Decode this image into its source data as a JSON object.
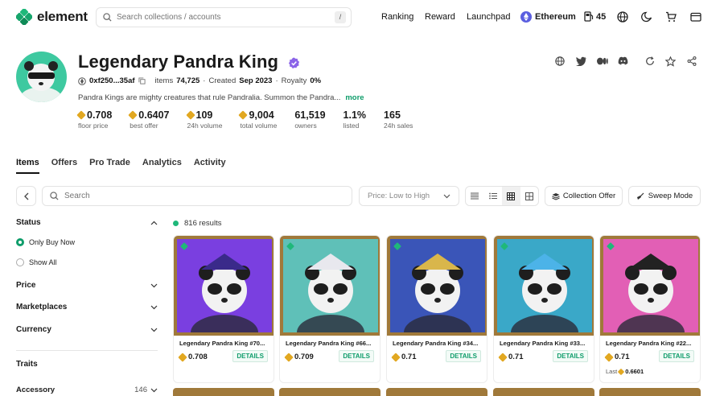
{
  "brand": {
    "name": "element",
    "accent": "#0f9d6b"
  },
  "search": {
    "placeholder": "Search collections / accounts",
    "shortcut": "/"
  },
  "nav": {
    "ranking": "Ranking",
    "reward": "Reward",
    "launchpad": "Launchpad",
    "chain": "Ethereum",
    "gas": "45"
  },
  "icons": {
    "globe": "globe-icon",
    "moon": "moon-icon",
    "cart": "cart-icon",
    "wallet": "wallet-icon"
  },
  "collection": {
    "name": "Legendary Pandra King",
    "address": "0xf250...35af",
    "items_label": "items",
    "items": "74,725",
    "created_label": "Created",
    "created": "Sep 2023",
    "royalty_label": "Royalty",
    "royalty": "0%",
    "description": "Pandra Kings are mighty creatures that rule Pandralia. Summon the Pandra...",
    "more": "more"
  },
  "stats": [
    {
      "value": "0.708",
      "label": "floor price",
      "token": true
    },
    {
      "value": "0.6407",
      "label": "best offer",
      "token": true
    },
    {
      "value": "109",
      "label": "24h volume",
      "token": true
    },
    {
      "value": "9,004",
      "label": "total volume",
      "token": true
    },
    {
      "value": "61,519",
      "label": "owners",
      "token": false
    },
    {
      "value": "1.1%",
      "label": "listed",
      "token": false
    },
    {
      "value": "165",
      "label": "24h sales",
      "token": false
    }
  ],
  "tabs": [
    "Items",
    "Offers",
    "Pro Trade",
    "Analytics",
    "Activity"
  ],
  "toolbar": {
    "search_placeholder": "Search",
    "sort": "Price: Low to High",
    "collection_offer": "Collection Offer",
    "sweep": "Sweep Mode"
  },
  "filters": {
    "status": "Status",
    "only_buy_now": "Only Buy Now",
    "show_all": "Show All",
    "price": "Price",
    "marketplaces": "Marketplaces",
    "currency": "Currency",
    "traits": "Traits",
    "accessory": "Accessory",
    "accessory_count": "146"
  },
  "results": "816 results",
  "cards": [
    {
      "name": "Legendary Pandra King #70...",
      "price": "0.708",
      "details": "DETAILS",
      "bg": "#7a3fe0",
      "hat": "#3a2a8a"
    },
    {
      "name": "Legendary Pandra King #66...",
      "price": "0.709",
      "details": "DETAILS",
      "bg": "#5fc0b8",
      "hat": "#e8e8ee"
    },
    {
      "name": "Legendary Pandra King #34...",
      "price": "0.71",
      "details": "DETAILS",
      "bg": "#3a55b8",
      "hat": "#d9b64b"
    },
    {
      "name": "Legendary Pandra King #33...",
      "price": "0.71",
      "details": "DETAILS",
      "bg": "#3aa8c8",
      "hat": "#4cb3e8"
    },
    {
      "name": "Legendary Pandra King #22...",
      "price": "0.71",
      "details": "DETAILS",
      "bg": "#e25fb5",
      "hat": "#222222",
      "last_label": "Last",
      "last": "0.6601"
    }
  ]
}
